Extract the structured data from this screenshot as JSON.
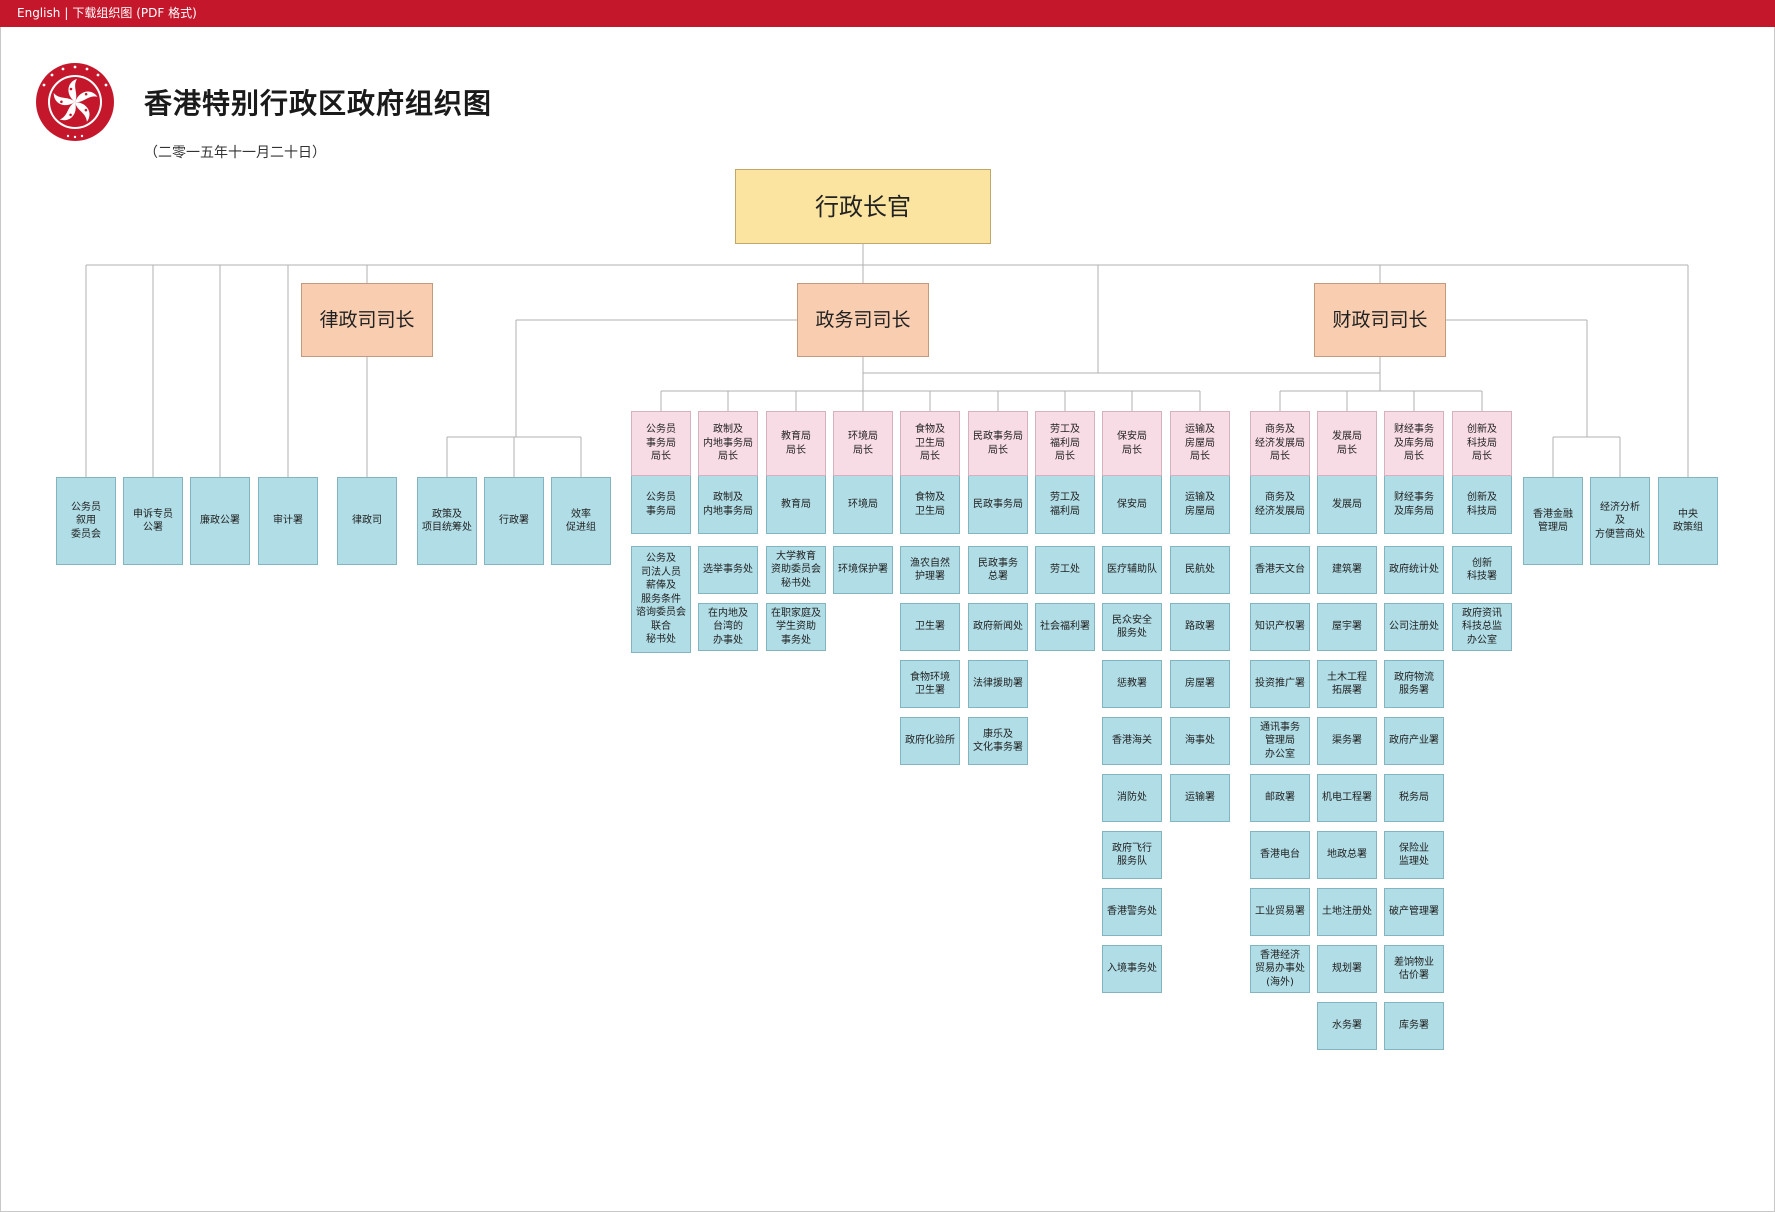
{
  "header": {
    "lang_link": "English",
    "separator": "|",
    "download_link": "下载组织图 (PDF 格式)"
  },
  "title": "香港特别行政区政府组织图",
  "date": "（二零一五年十一月二十日）",
  "colors": {
    "top_bar": "#c4172c",
    "chief": "#fae4a0",
    "secretary": "#f9ceb0",
    "bureau_head": "#f8dce5",
    "department": "#b0dde6"
  },
  "chief": "行政长官",
  "secretaries": {
    "justice": "律政司司长",
    "admin": "政务司司长",
    "financial": "财政司司长"
  },
  "ce_direct": [
    "公务员\n叙用\n委员会",
    "申诉专员\n公署",
    "廉政公署",
    "审计署"
  ],
  "doj": "律政司",
  "cs_office": [
    "政策及\n项目统筹处",
    "行政署",
    "效率\n促进组"
  ],
  "fs_direct": [
    "香港金融\n管理局",
    "经济分析\n及\n方便营商处"
  ],
  "central_policy_unit": "中央\n政策组",
  "bureaus": [
    {
      "head": "公务员\n事务局\n局长",
      "bureau": "公务员\n事务局",
      "depts": [
        "公务及\n司法人员\n薪俸及\n服务条件\n谘询委员会\n联合\n秘书处"
      ]
    },
    {
      "head": "政制及\n内地事务局\n局长",
      "bureau": "政制及\n内地事务局",
      "depts": [
        "选举事务处",
        "在内地及\n台湾的\n办事处"
      ]
    },
    {
      "head": "教育局\n局长",
      "bureau": "教育局",
      "depts": [
        "大学教育\n资助委员会\n秘书处",
        "在职家庭及\n学生资助\n事务处"
      ]
    },
    {
      "head": "环境局\n局长",
      "bureau": "环境局",
      "depts": [
        "环境保护署"
      ]
    },
    {
      "head": "食物及\n卫生局\n局长",
      "bureau": "食物及\n卫生局",
      "depts": [
        "渔农自然\n护理署",
        "卫生署",
        "食物环境\n卫生署",
        "政府化验所"
      ]
    },
    {
      "head": "民政事务局\n局长",
      "bureau": "民政事务局",
      "depts": [
        "民政事务\n总署",
        "政府新闻处",
        "法律援助署",
        "康乐及\n文化事务署"
      ]
    },
    {
      "head": "劳工及\n福利局\n局长",
      "bureau": "劳工及\n福利局",
      "depts": [
        "劳工处",
        "社会福利署"
      ]
    },
    {
      "head": "保安局\n局长",
      "bureau": "保安局",
      "depts": [
        "医疗辅助队",
        "民众安全\n服务处",
        "惩教署",
        "香港海关",
        "消防处",
        "政府飞行\n服务队",
        "香港警务处",
        "入境事务处"
      ]
    },
    {
      "head": "运输及\n房屋局\n局长",
      "bureau": "运输及\n房屋局",
      "depts": [
        "民航处",
        "路政署",
        "房屋署",
        "海事处",
        "运输署"
      ]
    },
    {
      "head": "商务及\n经济发展局\n局长",
      "bureau": "商务及\n经济发展局",
      "depts": [
        "香港天文台",
        "知识产权署",
        "投资推广署",
        "通讯事务\n管理局\n办公室",
        "邮政署",
        "香港电台",
        "工业贸易署",
        "香港经济\n贸易办事处\n(海外)"
      ]
    },
    {
      "head": "发展局\n局长",
      "bureau": "发展局",
      "depts": [
        "建筑署",
        "屋宇署",
        "土木工程\n拓展署",
        "渠务署",
        "机电工程署",
        "地政总署",
        "土地注册处",
        "规划署",
        "水务署"
      ]
    },
    {
      "head": "财经事务\n及库务局\n局长",
      "bureau": "财经事务\n及库务局",
      "depts": [
        "政府统计处",
        "公司注册处",
        "政府物流\n服务署",
        "政府产业署",
        "税务局",
        "保险业\n监理处",
        "破产管理署",
        "差饷物业\n估价署",
        "库务署"
      ]
    },
    {
      "head": "创新及\n科技局\n局长",
      "bureau": "创新及\n科技局",
      "depts": [
        "创新\n科技署",
        "政府资讯\n科技总监\n办公室"
      ]
    }
  ]
}
